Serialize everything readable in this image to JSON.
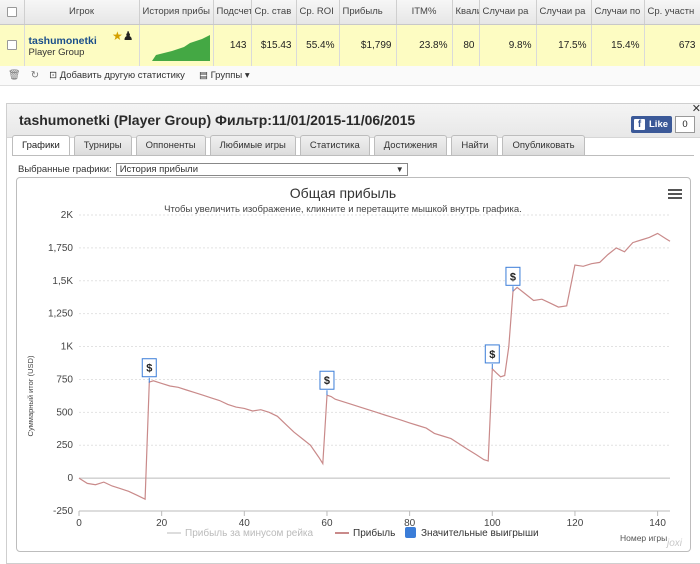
{
  "stats": {
    "headers": [
      "Игрок",
      "История прибы",
      "Подсчет",
      "Ср. став",
      "Ср. ROI",
      "Прибыль",
      "ITM%",
      "Квали",
      "Случаи ра",
      "Случаи ра",
      "Случаи по",
      "Ср. участн"
    ],
    "row": {
      "player_name": "tashumonetki",
      "player_group": "Player Group",
      "count": "143",
      "avg_stake": "$15.43",
      "avg_roi": "55.4%",
      "profit": "$1,799",
      "itm": "23.8%",
      "quali": "80",
      "case1": "9.8%",
      "case2": "17.5%",
      "case3": "15.4%",
      "avg_participants": "673"
    }
  },
  "toolbar": {
    "add_stats": "Добавить другую статистику",
    "groups": "Группы"
  },
  "panel": {
    "title": "tashumonetki (Player Group) Фильтр:11/01/2015-11/06/2015",
    "like_label": "Like",
    "like_count": "0",
    "tabs": [
      "Графики",
      "Турниры",
      "Оппоненты",
      "Любимые игры",
      "Статистика",
      "Достижения",
      "Найти",
      "Опубликовать"
    ],
    "selected_label": "Выбранные графики:",
    "selected_value": "История прибыли"
  },
  "chart_data": {
    "type": "line",
    "title": "Общая прибыль",
    "subtitle": "Чтобы увеличить изображение, кликните и перетащите мышкой внутрь графика.",
    "ylabel": "Суммарный итог (USD)",
    "xlabel": "Номер игры",
    "xlim": [
      0,
      143
    ],
    "ylim": [
      -250,
      2000
    ],
    "yticks": [
      "2K",
      "1,750",
      "1,5K",
      "1,250",
      "1K",
      "750",
      "500",
      "250",
      "0",
      "-250"
    ],
    "xticks": [
      "0",
      "20",
      "40",
      "60",
      "80",
      "100",
      "120",
      "140"
    ],
    "legend": [
      "Прибыль за минусом рейка",
      "Прибыль",
      "Значительные выигрыши"
    ],
    "legend_position": "bottom",
    "colors": {
      "profit": "#c98a8a",
      "rake": "#dddddd",
      "big": "#3b7dd8"
    },
    "big_win_marker": "$",
    "big_wins": [
      {
        "x": 17,
        "y": 725
      },
      {
        "x": 60,
        "y": 630
      },
      {
        "x": 100,
        "y": 830
      },
      {
        "x": 105,
        "y": 1420
      }
    ],
    "profit": [
      [
        0,
        0
      ],
      [
        2,
        -40
      ],
      [
        4,
        -50
      ],
      [
        6,
        -30
      ],
      [
        8,
        -60
      ],
      [
        10,
        -80
      ],
      [
        12,
        -100
      ],
      [
        14,
        -130
      ],
      [
        16,
        -160
      ],
      [
        17,
        730
      ],
      [
        18,
        740
      ],
      [
        20,
        720
      ],
      [
        22,
        700
      ],
      [
        24,
        690
      ],
      [
        26,
        670
      ],
      [
        28,
        650
      ],
      [
        30,
        630
      ],
      [
        32,
        610
      ],
      [
        34,
        590
      ],
      [
        36,
        560
      ],
      [
        38,
        540
      ],
      [
        40,
        530
      ],
      [
        42,
        510
      ],
      [
        44,
        520
      ],
      [
        46,
        500
      ],
      [
        48,
        470
      ],
      [
        50,
        410
      ],
      [
        52,
        350
      ],
      [
        54,
        300
      ],
      [
        56,
        250
      ],
      [
        58,
        160
      ],
      [
        59,
        110
      ],
      [
        60,
        630
      ],
      [
        61,
        620
      ],
      [
        62,
        600
      ],
      [
        64,
        580
      ],
      [
        66,
        560
      ],
      [
        68,
        540
      ],
      [
        70,
        520
      ],
      [
        72,
        500
      ],
      [
        74,
        480
      ],
      [
        76,
        460
      ],
      [
        78,
        440
      ],
      [
        80,
        420
      ],
      [
        82,
        400
      ],
      [
        84,
        380
      ],
      [
        86,
        340
      ],
      [
        88,
        320
      ],
      [
        90,
        300
      ],
      [
        92,
        260
      ],
      [
        94,
        220
      ],
      [
        96,
        180
      ],
      [
        98,
        140
      ],
      [
        99,
        130
      ],
      [
        100,
        830
      ],
      [
        101,
        800
      ],
      [
        102,
        770
      ],
      [
        103,
        780
      ],
      [
        104,
        1000
      ],
      [
        105,
        1420
      ],
      [
        106,
        1450
      ],
      [
        108,
        1400
      ],
      [
        110,
        1350
      ],
      [
        112,
        1360
      ],
      [
        114,
        1330
      ],
      [
        116,
        1300
      ],
      [
        118,
        1310
      ],
      [
        120,
        1620
      ],
      [
        122,
        1610
      ],
      [
        124,
        1630
      ],
      [
        126,
        1640
      ],
      [
        128,
        1700
      ],
      [
        130,
        1750
      ],
      [
        132,
        1720
      ],
      [
        134,
        1790
      ],
      [
        136,
        1810
      ],
      [
        138,
        1830
      ],
      [
        140,
        1860
      ],
      [
        142,
        1820
      ],
      [
        143,
        1800
      ]
    ]
  }
}
